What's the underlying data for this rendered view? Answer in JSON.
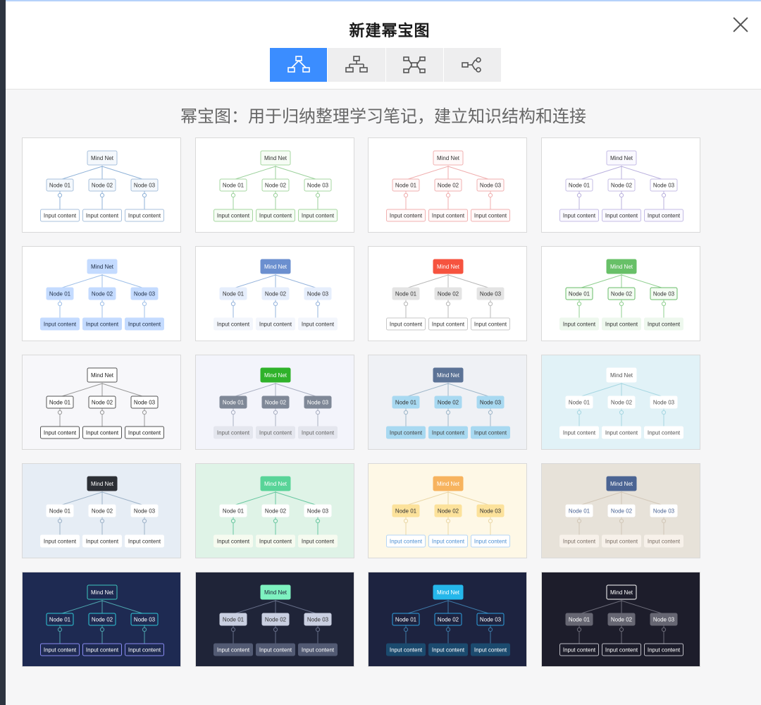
{
  "dialog": {
    "title": "新建幂宝图",
    "description": "幂宝图：用于归纳整理学习笔记，建立知识结构和连接"
  },
  "tabs": [
    {
      "name": "tree-down-icon",
      "active": true
    },
    {
      "name": "org-chart-icon",
      "active": false
    },
    {
      "name": "radial-map-icon",
      "active": false
    },
    {
      "name": "right-branch-icon",
      "active": false
    }
  ],
  "template_text": {
    "root": "Mind Net",
    "nodes": [
      "Node 01",
      "Node 02",
      "Node 03"
    ],
    "leaf": "Input content"
  },
  "templates": [
    {
      "bg": "#ffffff",
      "line": "#8fb2d8",
      "rootFill": "#f4f8fc",
      "rootStroke": "#a8c1dc",
      "rootText": "#333333",
      "nodeFill": "#f4f8fc",
      "nodeStroke": "#a8c1dc",
      "nodeText": "#333333",
      "leafFill": "#ffffff",
      "leafStroke": "#a8c1dc",
      "leafText": "#333333"
    },
    {
      "bg": "#ffffff",
      "line": "#9bd19b",
      "rootFill": "#f6fcf5",
      "rootStroke": "#a6d7a0",
      "rootText": "#333333",
      "nodeFill": "#ffffff",
      "nodeStroke": "#a6d7a0",
      "nodeText": "#333333",
      "leafFill": "#f6fcf5",
      "leafStroke": "#a6d7a0",
      "leafText": "#333333"
    },
    {
      "bg": "#ffffff",
      "line": "#f0aeae",
      "rootFill": "#fff9f9",
      "rootStroke": "#f1b1b1",
      "rootText": "#333333",
      "nodeFill": "#fff9f9",
      "nodeStroke": "#f1b1b1",
      "nodeText": "#333333",
      "leafFill": "#fff9f9",
      "leafStroke": "#f1b1b1",
      "leafText": "#333333"
    },
    {
      "bg": "#ffffff",
      "line": "#b9b0de",
      "rootFill": "#faf9ff",
      "rootStroke": "#c4bce6",
      "rootText": "#333333",
      "nodeFill": "#ffffff",
      "nodeStroke": "#c4bce6",
      "nodeText": "#333333",
      "leafFill": "#faf9ff",
      "leafStroke": "#c4bce6",
      "leafText": "#333333"
    },
    {
      "bg": "#ffffff",
      "line": "#9ebfe8",
      "rootFill": "#c4dbff",
      "rootStroke": "#c4dbff",
      "rootText": "#22324a",
      "nodeFill": "#c4dbff",
      "nodeStroke": "#c4dbff",
      "nodeText": "#22324a",
      "leafFill": "#c4dbff",
      "leafStroke": "#c4dbff",
      "leafText": "#22324a"
    },
    {
      "bg": "#ffffff",
      "line": "#96b4dc",
      "rootFill": "#6b8fcf",
      "rootStroke": "#6b8fcf",
      "rootText": "#ffffff",
      "nodeFill": "#e6eefc",
      "nodeStroke": "#e6eefc",
      "nodeText": "#333333",
      "leafFill": "#f3f6fc",
      "leafStroke": "#f3f6fc",
      "leafText": "#333333"
    },
    {
      "bg": "#ffffff",
      "line": "#b8b8b8",
      "rootFill": "#f6533f",
      "rootStroke": "#f6533f",
      "rootText": "#ffffff",
      "nodeFill": "#e4e4e4",
      "nodeStroke": "#e4e4e4",
      "nodeText": "#333333",
      "leafFill": "#ffffff",
      "leafStroke": "#c8c8c8",
      "leafText": "#333333"
    },
    {
      "bg": "#ffffff",
      "line": "#8fcf8f",
      "rootFill": "#68c068",
      "rootStroke": "#68c068",
      "rootText": "#ffffff",
      "nodeFill": "#f4fcf3",
      "nodeStroke": "#69bc69",
      "nodeText": "#333333",
      "leafFill": "#eef8ee",
      "leafStroke": "#eef8ee",
      "leafText": "#333333"
    },
    {
      "bg": "#f7f7fa",
      "line": "#9a9a9a",
      "rootFill": "#ffffff",
      "rootStroke": "#555555",
      "rootText": "#222222",
      "nodeFill": "#ffffff",
      "nodeStroke": "#555555",
      "nodeText": "#222222",
      "leafFill": "#ffffff",
      "leafStroke": "#555555",
      "leafText": "#222222"
    },
    {
      "bg": "#f3f4fb",
      "line": "#aab0c2",
      "rootFill": "#2fb22a",
      "rootStroke": "#2fb22a",
      "rootText": "#ffffff",
      "nodeFill": "#7f8897",
      "nodeStroke": "#7f8897",
      "nodeText": "#ffffff",
      "leafFill": "#e4e6ee",
      "leafStroke": "#e4e6ee",
      "leafText": "#666666"
    },
    {
      "bg": "#eff1f5",
      "line": "#9fb7c9",
      "rootFill": "#5c7396",
      "rootStroke": "#5c7396",
      "rootText": "#ffffff",
      "nodeFill": "#a8d9f1",
      "nodeStroke": "#a8d9f1",
      "nodeText": "#333333",
      "leafFill": "#a8d9f1",
      "leafStroke": "#a8d9f1",
      "leafText": "#444444"
    },
    {
      "bg": "#e1f2f7",
      "line": "#a7d7e2",
      "rootFill": "#ffffff",
      "rootStroke": "#ffffff",
      "rootText": "#555555",
      "nodeFill": "#ffffff",
      "nodeStroke": "#ffffff",
      "nodeText": "#555555",
      "leafFill": "#ffffff",
      "leafStroke": "#ffffff",
      "leafText": "#555555"
    },
    {
      "bg": "#e6edf5",
      "line": "#9eb3c8",
      "rootFill": "#2c2f35",
      "rootStroke": "#2c2f35",
      "rootText": "#ffffff",
      "nodeFill": "#ffffff",
      "nodeStroke": "#ffffff",
      "nodeText": "#333333",
      "leafFill": "#ffffff",
      "leafStroke": "#ffffff",
      "leafText": "#333333"
    },
    {
      "bg": "#dff3e7",
      "line": "#69c7a1",
      "rootFill": "#58d498",
      "rootStroke": "#58d498",
      "rootText": "#ffffff",
      "nodeFill": "#ffffff",
      "nodeStroke": "#ffffff",
      "nodeText": "#333333",
      "leafFill": "#f6fbf0",
      "leafStroke": "#f6fbf0",
      "leafText": "#333333"
    },
    {
      "bg": "#fef8e6",
      "line": "#ead7a7",
      "rootFill": "#f7b35e",
      "rootStroke": "#f7b35e",
      "rootText": "#ffffff",
      "nodeFill": "#fce29b",
      "nodeStroke": "#fce29b",
      "nodeText": "#333333",
      "leafFill": "#ffffff",
      "leafStroke": "#b5d6f6",
      "leafText": "#4d8fd3"
    },
    {
      "bg": "#e7e2d9",
      "line": "#d2c7b8",
      "rootFill": "#4b6493",
      "rootStroke": "#4b6493",
      "rootText": "#ffffff",
      "nodeFill": "#ffffff",
      "nodeStroke": "#ffffff",
      "nodeText": "#4b6493",
      "leafFill": "#f7f1ea",
      "leafStroke": "#f7f1ea",
      "leafText": "#7a6e65"
    },
    {
      "bg": "#1e2a52",
      "line": "#4da4ad",
      "rootFill": "#1e2a52",
      "rootStroke": "#3cc7bf",
      "rootText": "#ffffff",
      "nodeFill": "#1e2a52",
      "nodeStroke": "#2ec8d8",
      "nodeText": "#ffffff",
      "leafFill": "#1e2a52",
      "leafStroke": "#8a8cf2",
      "leafText": "#ffffff"
    },
    {
      "bg": "#1f2438",
      "line": "#666e88",
      "rootFill": "#7ef2c0",
      "rootStroke": "#7ef2c0",
      "rootText": "#1f2438",
      "nodeFill": "#c9cfe1",
      "nodeStroke": "#c9cfe1",
      "nodeText": "#333333",
      "leafFill": "#525a73",
      "leafStroke": "#525a73",
      "leafText": "#ffffff"
    },
    {
      "bg": "#1d2340",
      "line": "#3d78a6",
      "rootFill": "#25b7eb",
      "rootStroke": "#25b7eb",
      "rootText": "#ffffff",
      "nodeFill": "#1d2340",
      "nodeStroke": "#2ea2e0",
      "nodeText": "#ffffff",
      "leafFill": "#1b4a6e",
      "leafStroke": "#1b4a6e",
      "leafText": "#ffffff"
    },
    {
      "bg": "#1d1d2b",
      "line": "#6b6b78",
      "rootFill": "#1d1d2b",
      "rootStroke": "#ffffff",
      "rootText": "#ffffff",
      "nodeFill": "#666672",
      "nodeStroke": "#666672",
      "nodeText": "#ffffff",
      "leafFill": "#1d1d2b",
      "leafStroke": "#bcbcc4",
      "leafText": "#ffffff"
    }
  ]
}
